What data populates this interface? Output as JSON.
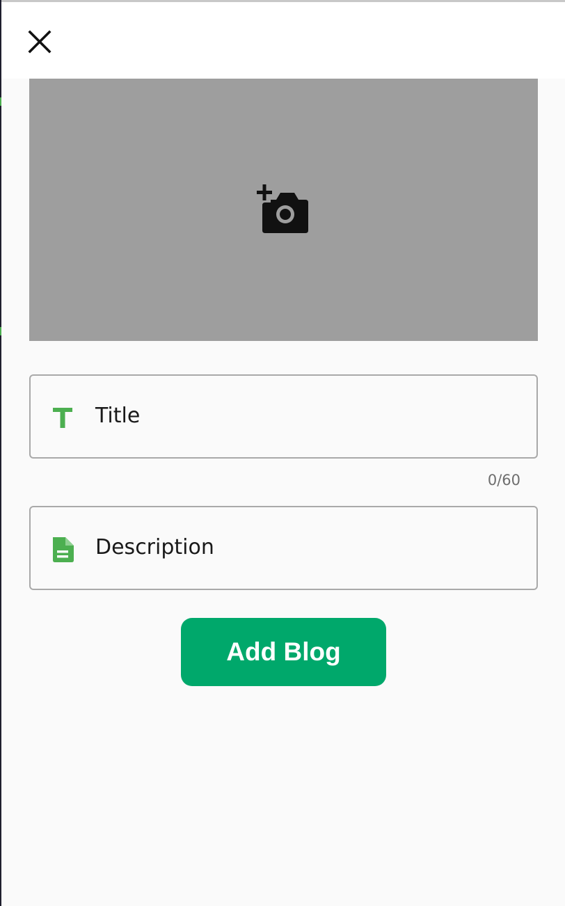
{
  "dialog": {
    "close_icon": "close-icon"
  },
  "image_upload": {
    "icon": "add-photo-camera-icon",
    "background_color": "#9e9e9e"
  },
  "title_field": {
    "icon": "text-title-icon",
    "label": "Title",
    "counter": "0/60",
    "icon_color": "#4caf50"
  },
  "description_field": {
    "icon": "document-icon",
    "label": "Description",
    "icon_color": "#4caf50"
  },
  "actions": {
    "submit_label": "Add Blog",
    "submit_color": "#00a86b"
  }
}
